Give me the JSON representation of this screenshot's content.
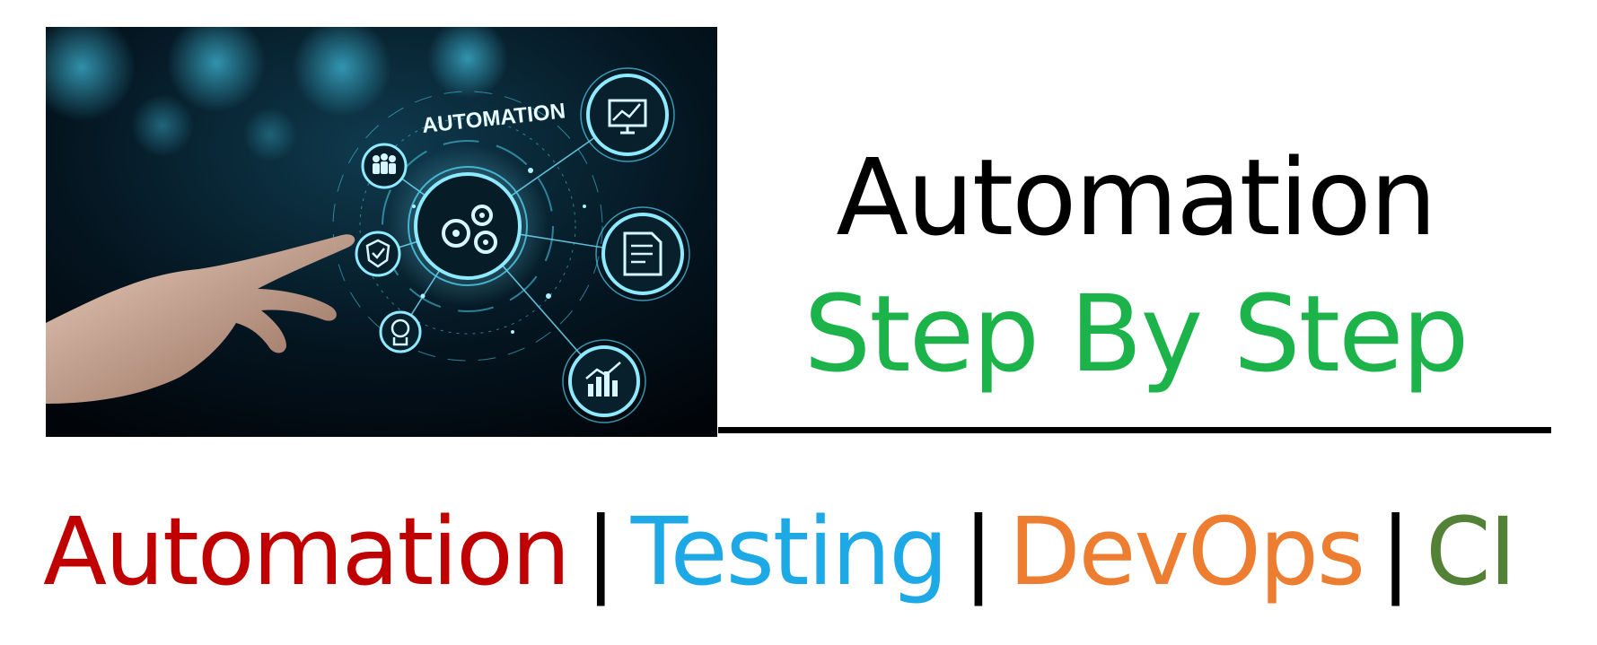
{
  "hero": {
    "overlay_text": "AUTOMATION",
    "icons": [
      "people-icon",
      "check-shield-icon",
      "gears-icon",
      "brain-icon",
      "chart-monitor-icon",
      "document-edit-icon",
      "bar-chart-icon",
      "hand-pointer-icon"
    ]
  },
  "title": {
    "main": "Automation",
    "sub": "Step By Step"
  },
  "topics": {
    "items": [
      "Automation",
      "Testing",
      "DevOps",
      "CI"
    ],
    "separator": "|"
  },
  "colors": {
    "title_main": "#000000",
    "title_sub": "#1db34b",
    "topic_automation": "#c00000",
    "topic_testing": "#1da9e6",
    "topic_devops": "#ed7d31",
    "topic_ci": "#538135",
    "hero_glow": "#4ecfee"
  }
}
